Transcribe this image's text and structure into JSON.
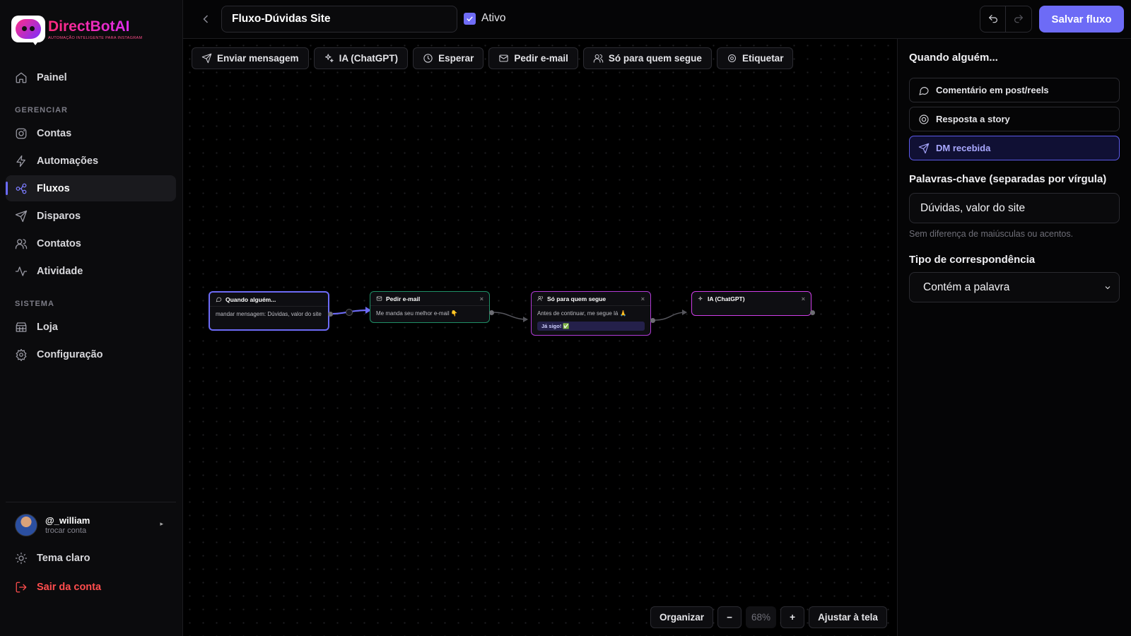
{
  "brand": {
    "name": "DirectBotAI",
    "tagline": "AUTOMAÇÃO INTELIGENTE PARA INSTAGRAM",
    "accent": "#6d6bf6"
  },
  "sidebar": {
    "home": {
      "label": "Painel",
      "icon": "home-icon"
    },
    "section_manage": "GERENCIAR",
    "manage_items": [
      {
        "label": "Contas",
        "icon": "instagram-icon"
      },
      {
        "label": "Automações",
        "icon": "bolt-icon"
      },
      {
        "label": "Fluxos",
        "icon": "flow-icon",
        "active": true
      },
      {
        "label": "Disparos",
        "icon": "send-icon"
      },
      {
        "label": "Contatos",
        "icon": "users-icon"
      },
      {
        "label": "Atividade",
        "icon": "activity-icon"
      }
    ],
    "section_system": "SISTEMA",
    "system_items": [
      {
        "label": "Loja",
        "icon": "store-icon"
      },
      {
        "label": "Configuração",
        "icon": "gear-icon"
      }
    ],
    "user": {
      "handle": "@_william",
      "switch_label": "trocar conta"
    },
    "theme_label": "Tema claro",
    "logout_label": "Sair da conta"
  },
  "topbar": {
    "flow_name": "Fluxo-Dúvidas Site",
    "active_label": "Ativo",
    "active_checked": true,
    "save_label": "Salvar fluxo"
  },
  "toolbar": [
    {
      "label": "Enviar mensagem",
      "icon": "send-icon"
    },
    {
      "label": "IA (ChatGPT)",
      "icon": "sparkle-icon"
    },
    {
      "label": "Esperar",
      "icon": "clock-icon"
    },
    {
      "label": "Pedir e-mail",
      "icon": "mail-icon"
    },
    {
      "label": "Só para quem segue",
      "icon": "users-icon"
    },
    {
      "label": "Etiquetar",
      "icon": "tag-icon"
    }
  ],
  "nodes": {
    "trigger": {
      "title": "Quando alguém...",
      "body": "mandar mensagem: Dúvidas, valor do site"
    },
    "email": {
      "title": "Pedir e-mail",
      "body": "Me manda seu melhor e-mail 👇"
    },
    "follow": {
      "title": "Só para quem segue",
      "body": "Antes de continuar, me segue lá 🙏",
      "button": "Já sigo! ✅"
    },
    "ai": {
      "title": "IA (ChatGPT)"
    }
  },
  "zoom": {
    "organize_label": "Organizar",
    "minus": "−",
    "value": "68%",
    "plus": "+",
    "fit_label": "Ajustar à tela"
  },
  "panel": {
    "when_title": "Quando alguém...",
    "triggers": [
      {
        "label": "Comentário em post/reels",
        "icon": "comment-icon"
      },
      {
        "label": "Resposta a story",
        "icon": "story-icon"
      },
      {
        "label": "DM recebida",
        "icon": "send-icon",
        "selected": true
      }
    ],
    "keywords_title": "Palavras-chave (separadas por vírgula)",
    "keywords_value": "Dúvidas, valor do site",
    "keywords_hint": "Sem diferença de maiúsculas ou acentos.",
    "match_title": "Tipo de correspondência",
    "match_value": "Contém a palavra"
  }
}
